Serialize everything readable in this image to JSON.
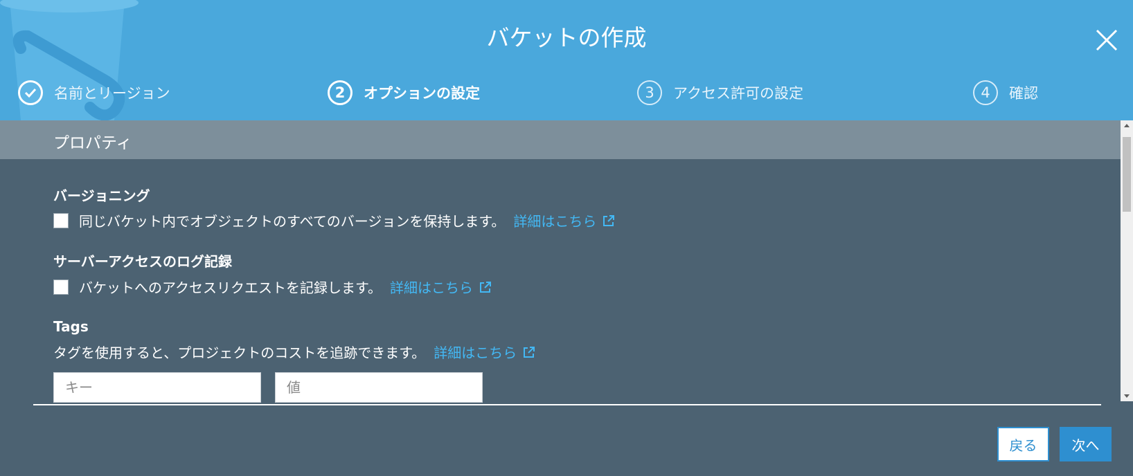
{
  "dialog": {
    "title": "バケットの作成"
  },
  "steps": [
    {
      "number": "",
      "label": "名前とリージョン",
      "state": "done"
    },
    {
      "number": "2",
      "label": "オプションの設定",
      "state": "current"
    },
    {
      "number": "3",
      "label": "アクセス許可の設定",
      "state": "pending"
    },
    {
      "number": "4",
      "label": "確認",
      "state": "pending"
    }
  ],
  "section": {
    "title": "プロパティ"
  },
  "versioning": {
    "heading": "バージョニング",
    "description": "同じバケット内でオブジェクトのすべてのバージョンを保持します。",
    "link": "詳細はこちら",
    "checked": false
  },
  "logging": {
    "heading": "サーバーアクセスのログ記録",
    "description": "バケットへのアクセスリクエストを記録します。",
    "link": "詳細はこちら",
    "checked": false
  },
  "tags": {
    "heading": "Tags",
    "description": "タグを使用すると、プロジェクトのコストを追跡できます。",
    "link": "詳細はこちら",
    "key_placeholder": "キー",
    "value_placeholder": "値"
  },
  "footer": {
    "back_label": "戻る",
    "next_label": "次へ"
  },
  "colors": {
    "header_bg": "#4aa8dc",
    "body_bg": "#4c6272",
    "section_bg": "#7d8f9b",
    "link": "#43b8f4",
    "primary_button": "#2e8fd0"
  }
}
